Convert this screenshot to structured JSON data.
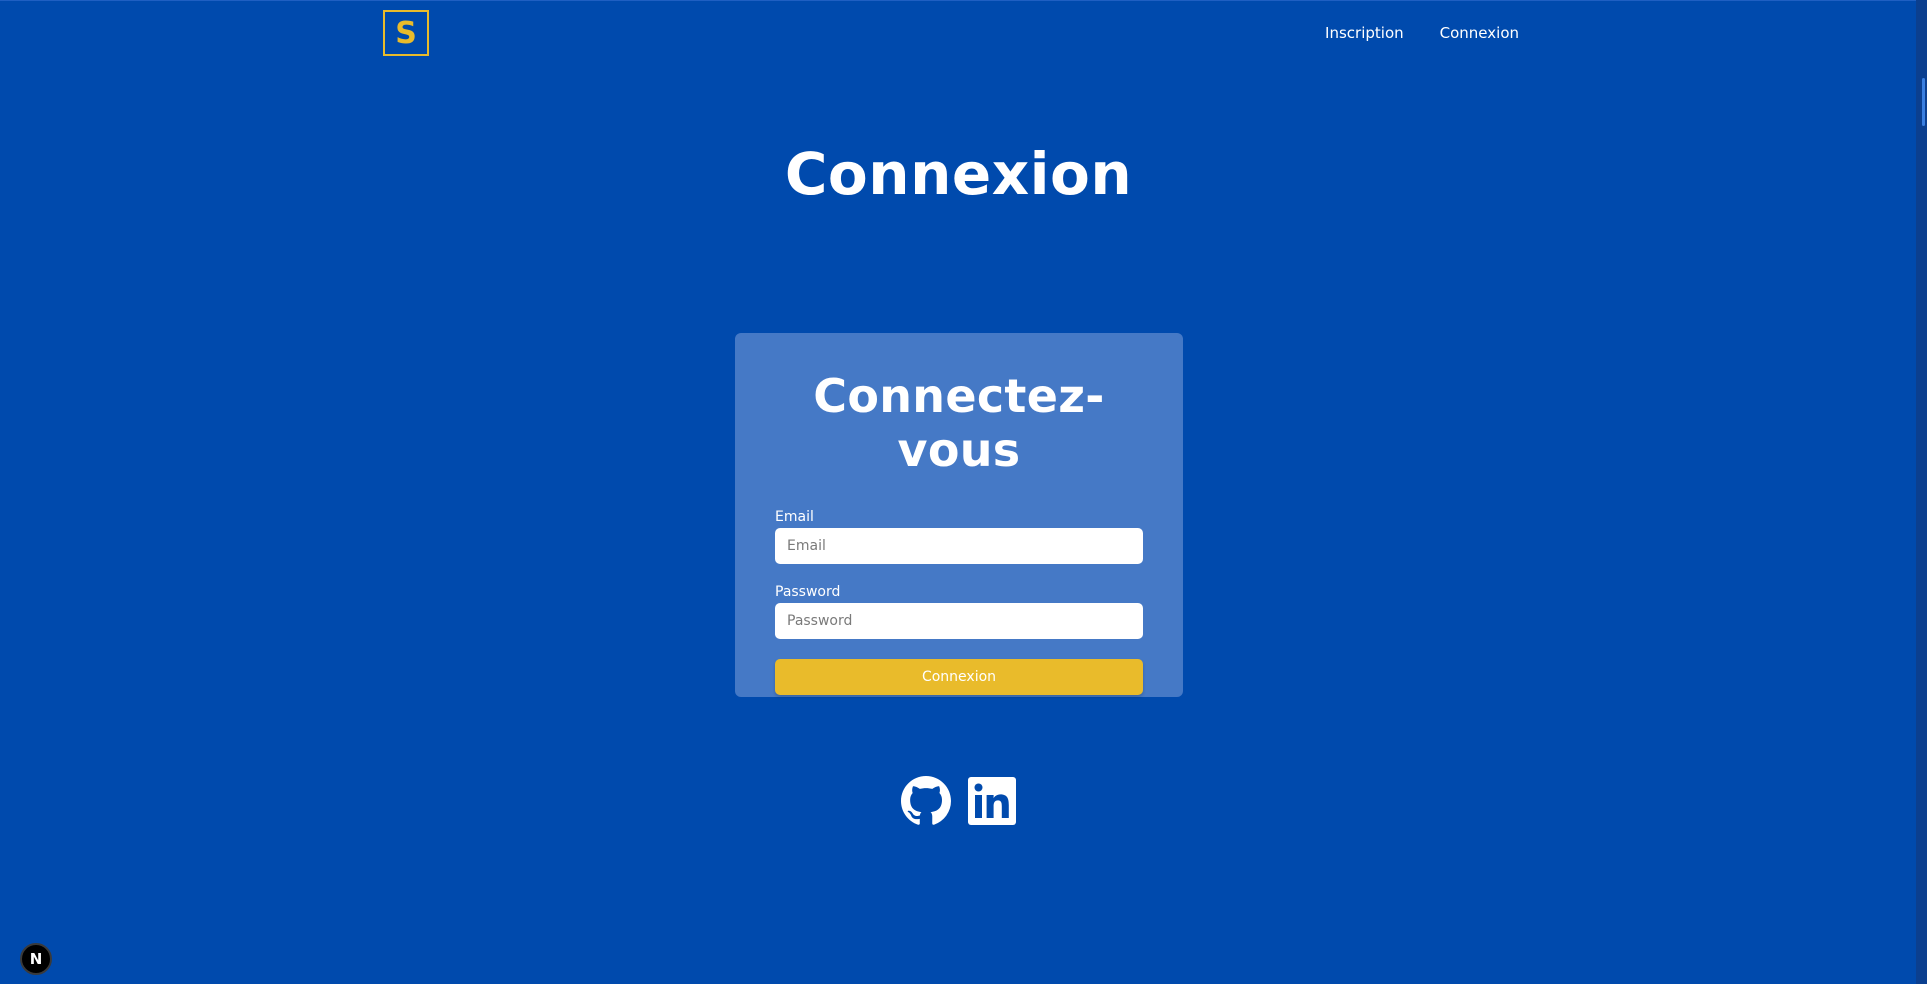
{
  "header": {
    "logo_letter": "S",
    "nav": [
      {
        "label": "Inscription"
      },
      {
        "label": "Connexion"
      }
    ]
  },
  "page": {
    "title": "Connexion"
  },
  "login_form": {
    "title": "Connectez-vous",
    "email_label": "Email",
    "email_placeholder": "Email",
    "email_value": "",
    "password_label": "Password",
    "password_placeholder": "Password",
    "password_value": "",
    "submit_label": "Connexion"
  },
  "socials": [
    {
      "icon": "github-icon"
    },
    {
      "icon": "linkedin-icon"
    }
  ],
  "dev_badge": {
    "letter": "N",
    "icon": "nextjs-icon"
  },
  "colors": {
    "background": "#004aad",
    "card": "#4579c6",
    "accent": "#e9bb2b",
    "text": "#ffffff"
  }
}
